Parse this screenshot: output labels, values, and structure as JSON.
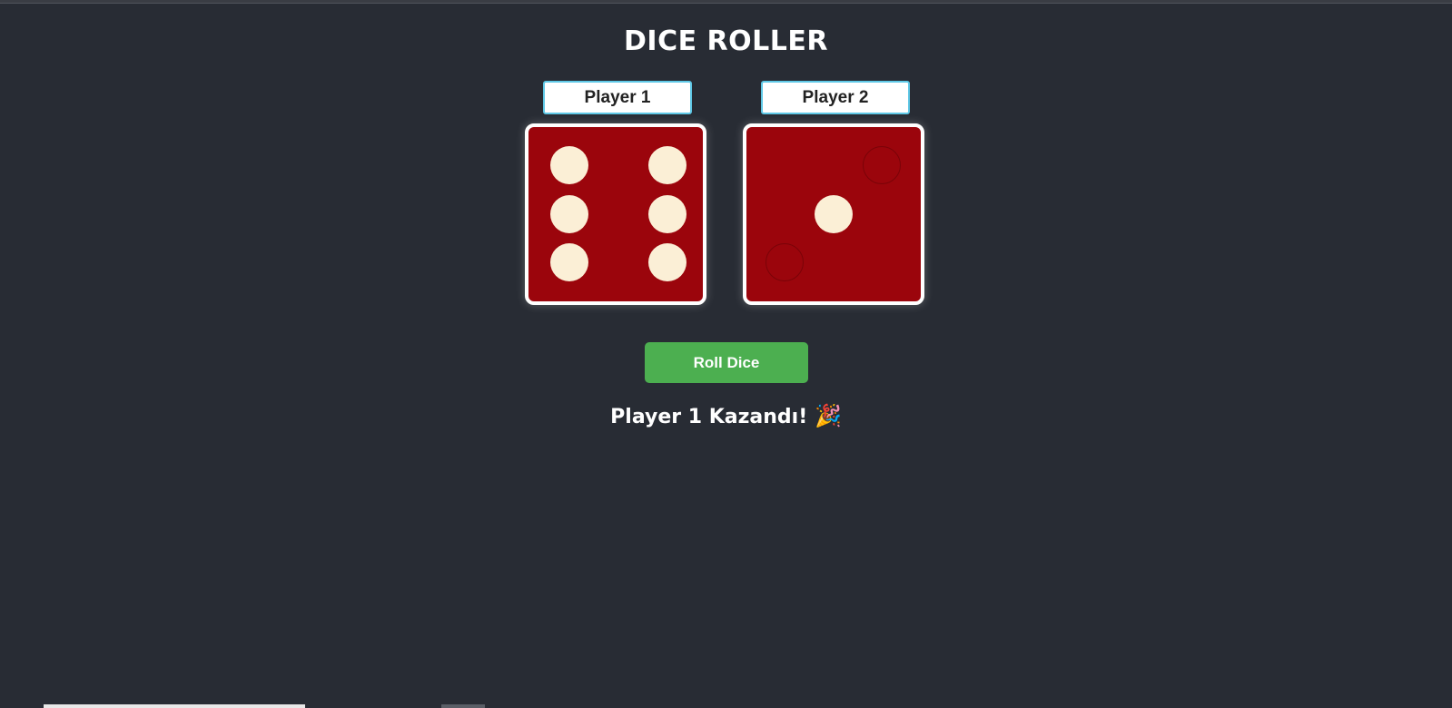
{
  "app": {
    "title": "DICE ROLLER"
  },
  "players": [
    {
      "name": "Player 1",
      "die_value": 6
    },
    {
      "name": "Player 2",
      "die_value": 1
    }
  ],
  "controls": {
    "roll_label": "Roll Dice"
  },
  "result": {
    "text": "Player 1 Kazandı!",
    "emoji": "🎉"
  },
  "colors": {
    "background": "#282c34",
    "die_face": "#9b050c",
    "pip": "#fbefd6",
    "button": "#4caf50",
    "input_border": "#5fc8e6"
  }
}
